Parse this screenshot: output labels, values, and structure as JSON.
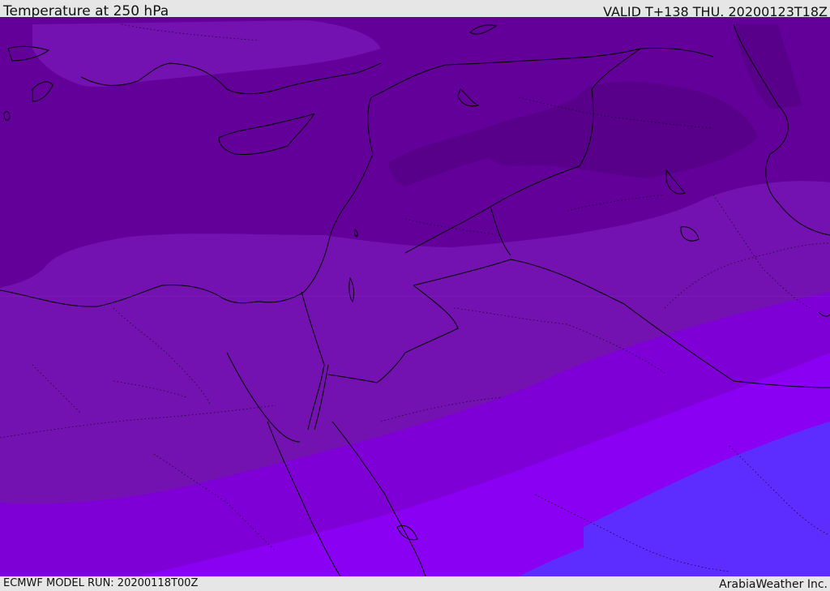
{
  "header": {
    "title": "Temperature at 250 hPa",
    "valid_time": "VALID T+138 THU. 20200123T18Z"
  },
  "footer": {
    "model_run": "ECMWF MODEL RUN: 20200118T00Z",
    "credit": "ArabiaWeather Inc."
  },
  "map": {
    "variable": "temperature",
    "level": "250 hPa",
    "region": "Eastern Mediterranean / Middle East",
    "colors": {
      "darkest_core": "#58008a",
      "dark_band": "#63009a",
      "mid_band": "#7312b0",
      "light_band": "#7e00d6",
      "bright_band": "#8a00f2",
      "blue_band": "#5d2cff",
      "coastline": "#000000"
    }
  }
}
